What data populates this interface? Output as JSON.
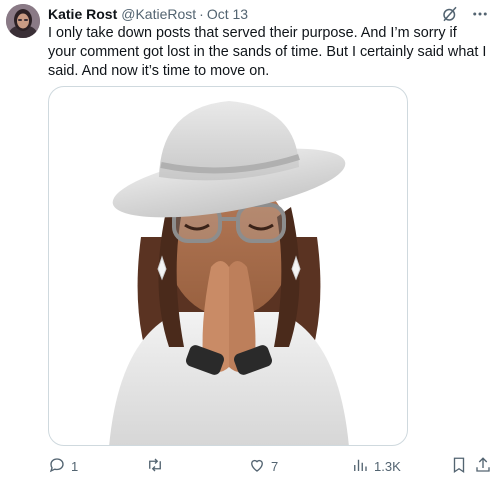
{
  "tweet": {
    "author_name": "Katie Rost",
    "author_handle": "@KatieRost",
    "separator": "·",
    "date": "Oct 13",
    "text": "I only take down posts that served their purpose. And I’m sorry if your comment got lost in the sands of time. But I certainly said what I said. And now it’s time to move on."
  },
  "media": {
    "description_icon": "memoji-praying-hands-with-white-hat"
  },
  "actions": {
    "replies": "1",
    "retweets": "",
    "likes": "7",
    "views": "1.3K"
  },
  "icons": {
    "avatar": "avatar",
    "grok": "grok-icon",
    "more": "more-icon",
    "reply": "reply-icon",
    "retweet": "retweet-icon",
    "like": "heart-icon",
    "views": "views-icon",
    "bookmark": "bookmark-icon",
    "share": "share-icon"
  },
  "colors": {
    "text": "#0f1419",
    "secondary": "#536471",
    "border": "#cfd9de"
  }
}
